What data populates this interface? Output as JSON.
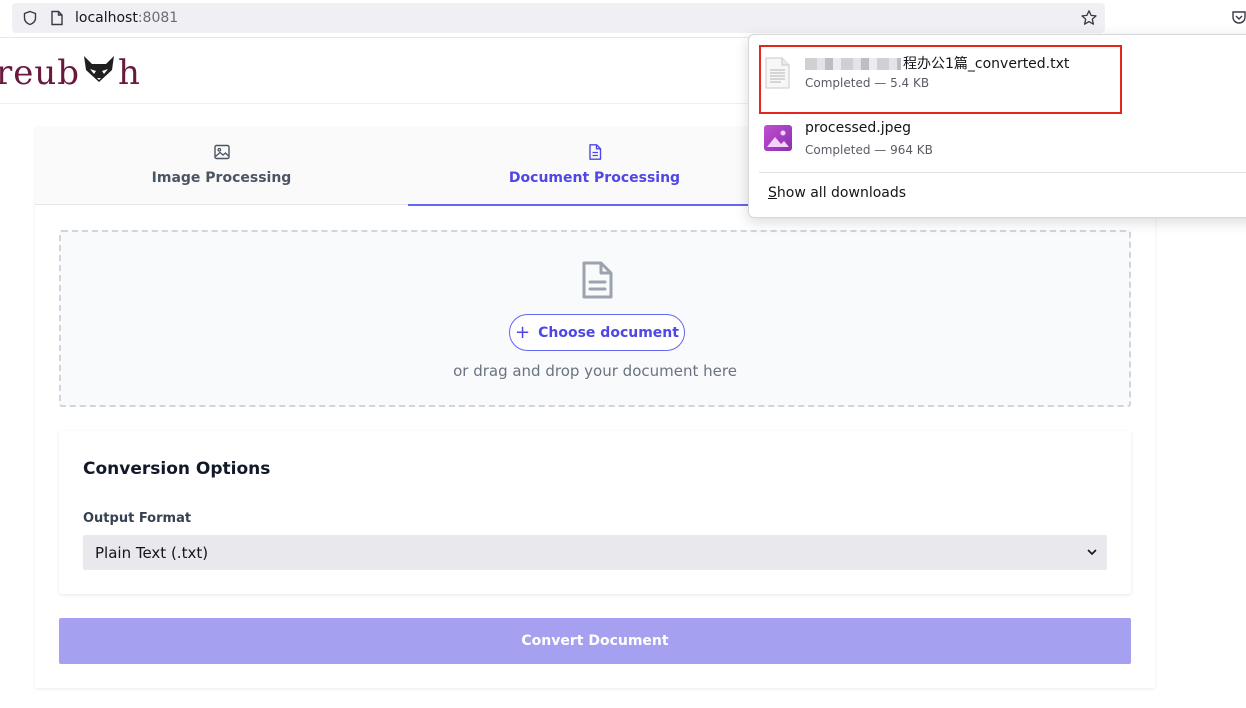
{
  "browser": {
    "url_host": "localhost",
    "url_port": ":8081"
  },
  "app": {
    "logo_left": "reub",
    "logo_right": "h"
  },
  "tabs": [
    {
      "label": "Image Processing",
      "active": false
    },
    {
      "label": "Document Processing",
      "active": true
    }
  ],
  "dropzone": {
    "choose_label": "Choose document",
    "drag_text": "or drag and drop your document here"
  },
  "options": {
    "title": "Conversion Options",
    "output_label": "Output Format",
    "output_value": "Plain Text (.txt)"
  },
  "convert_label": "Convert Document",
  "downloads": {
    "items": [
      {
        "name_visible": "程办公1篇_converted.txt",
        "status": "Completed — 5.4 KB",
        "icon": "text-file-icon"
      },
      {
        "name_visible": "processed.jpeg",
        "status": "Completed — 964 KB",
        "icon": "image-file-icon"
      }
    ],
    "show_all_prefix": "S",
    "show_all_rest": "how all downloads"
  },
  "colors": {
    "accent": "#4f46e5",
    "convert_button": "#a5a1f0",
    "logo": "#6b1840",
    "highlight": "#e5261f"
  }
}
